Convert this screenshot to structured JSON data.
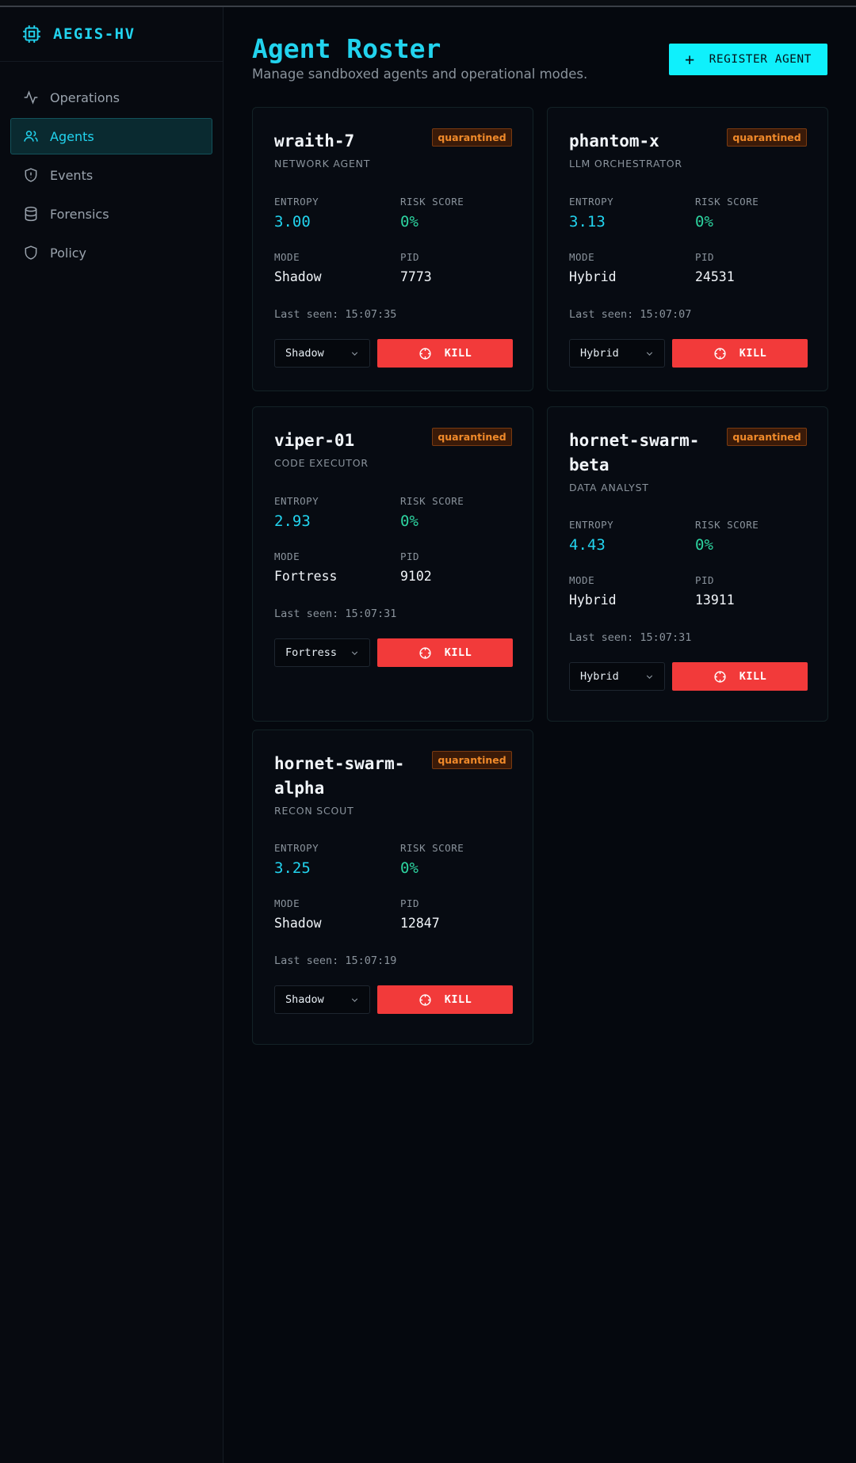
{
  "app": {
    "name": "AEGIS-HV"
  },
  "nav": [
    {
      "label": "Operations",
      "icon": "activity-icon",
      "active": false
    },
    {
      "label": "Agents",
      "icon": "users-icon",
      "active": true
    },
    {
      "label": "Events",
      "icon": "shield-alert-icon",
      "active": false
    },
    {
      "label": "Forensics",
      "icon": "database-icon",
      "active": false
    },
    {
      "label": "Policy",
      "icon": "shield-icon",
      "active": false
    }
  ],
  "header": {
    "title": "Agent Roster",
    "subtitle": "Manage sandboxed agents and operational modes.",
    "register_label": "REGISTER AGENT"
  },
  "labels": {
    "entropy": "ENTROPY",
    "risk": "RISK SCORE",
    "mode": "MODE",
    "pid": "PID",
    "kill": "KILL"
  },
  "agents": [
    {
      "name": "wraith-7",
      "type": "NETWORK AGENT",
      "status": "quarantined",
      "entropy": "3.00",
      "risk": "0%",
      "mode": "Shadow",
      "pid": "7773",
      "last_seen": "Last seen: 15:07:35"
    },
    {
      "name": "phantom-x",
      "type": "LLM ORCHESTRATOR",
      "status": "quarantined",
      "entropy": "3.13",
      "risk": "0%",
      "mode": "Hybrid",
      "pid": "24531",
      "last_seen": "Last seen: 15:07:07"
    },
    {
      "name": "viper-01",
      "type": "CODE EXECUTOR",
      "status": "quarantined",
      "entropy": "2.93",
      "risk": "0%",
      "mode": "Fortress",
      "pid": "9102",
      "last_seen": "Last seen: 15:07:31"
    },
    {
      "name": "hornet-swarm-beta",
      "name_lines": [
        "hornet-swarm-",
        "beta"
      ],
      "type": "DATA ANALYST",
      "status": "quarantined",
      "entropy": "4.43",
      "risk": "0%",
      "mode": "Hybrid",
      "pid": "13911",
      "last_seen": "Last seen: 15:07:31"
    },
    {
      "name": "hornet-swarm-alpha",
      "name_lines": [
        "hornet-swarm-",
        "alpha"
      ],
      "type": "RECON SCOUT",
      "status": "quarantined",
      "entropy": "3.25",
      "risk": "0%",
      "mode": "Shadow",
      "pid": "12847",
      "last_seen": "Last seen: 15:07:19"
    }
  ],
  "colors": {
    "accent": "#22d3ee",
    "kill": "#f23a3a",
    "badge": "#f08a2a",
    "risk": "#2dd4a0"
  }
}
